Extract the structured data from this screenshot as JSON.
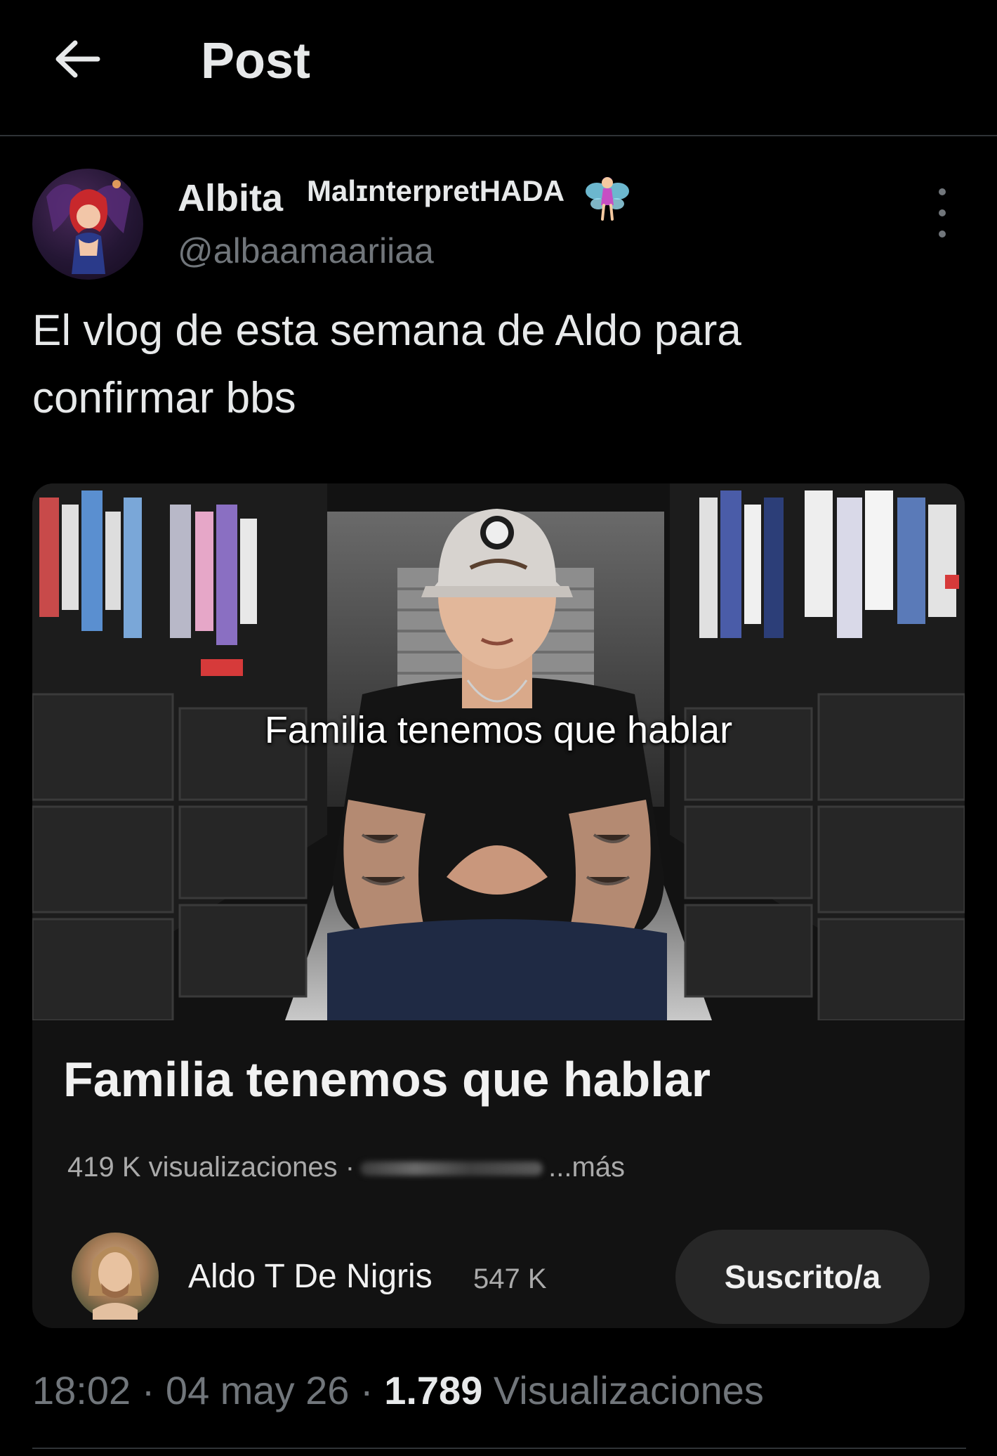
{
  "header": {
    "title": "Post",
    "back_icon": "arrow-left-icon"
  },
  "author": {
    "display_name": "Albita",
    "display_name_suffix": "MalɪnterpretHADA",
    "emoji_icon": "fairy-icon",
    "handle": "@albaamaariiaa",
    "more_icon": "more-vertical-icon"
  },
  "tweet": {
    "text_lines": [
      "El vlog de esta semana de Aldo para",
      "confirmar bbs"
    ]
  },
  "media": {
    "frame_caption": "Familia tenemos que hablar",
    "video_title": "Familia tenemos que hablar",
    "views": "419 K visualizaciones ·",
    "more_label": "...más",
    "channel_name": "Aldo T De Nigris",
    "channel_subscribers": "547 K",
    "subscribe_label": "Suscrito/a"
  },
  "post_meta": {
    "time": "18:02",
    "date": "04 may 26",
    "views_count": "1.789",
    "views_label": "Visualizaciones",
    "separator": "·"
  },
  "colors": {
    "background": "#000000",
    "primary_text": "#e7e9ea",
    "secondary_text": "#71767b",
    "divider": "#2f3336",
    "card_background": "#121212",
    "button_background": "#272727"
  }
}
